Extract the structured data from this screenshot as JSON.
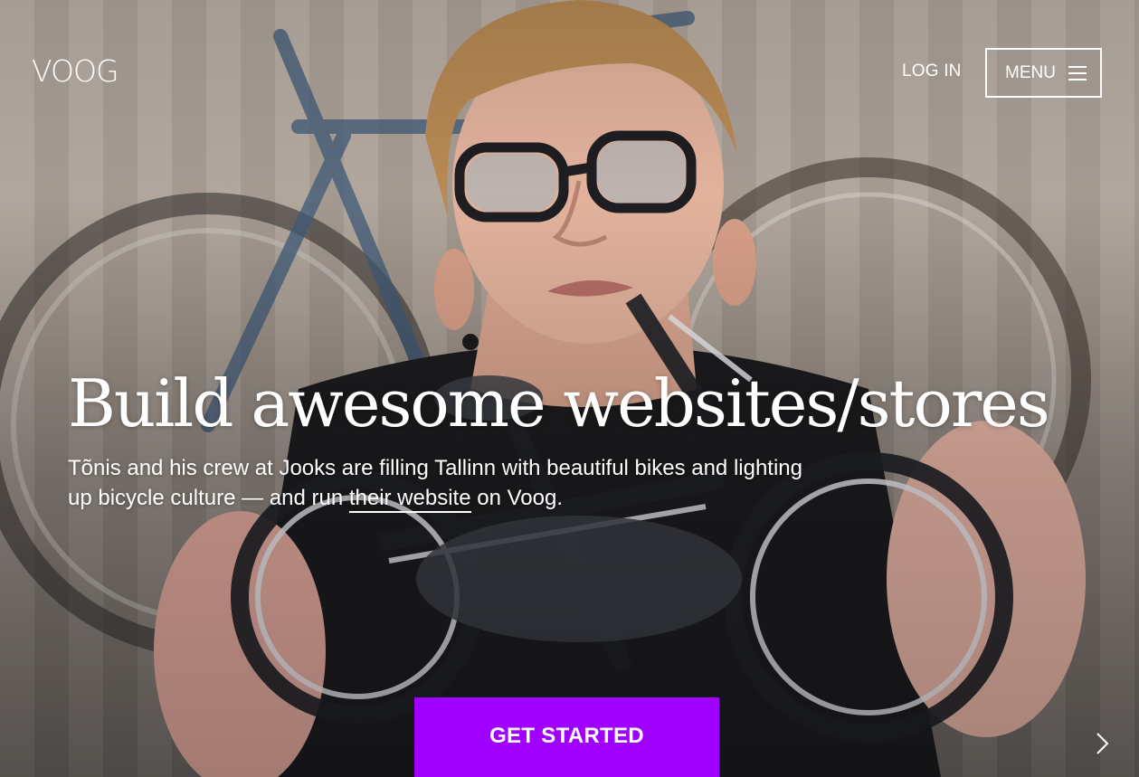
{
  "header": {
    "logo_text": "VOOG",
    "login_label": "LOG IN",
    "menu_label": "MENU",
    "menu_icon": "hamburger-menu-icon"
  },
  "hero": {
    "headline": "Build awesome websites/stores",
    "subtext_before_link": "Tõnis and his crew at Jooks are filling Tallinn with beautiful bikes and lighting up bicycle culture — and run ",
    "subtext_link": "their website",
    "subtext_after_link": " on Voog.",
    "cta_label": "GET STARTED",
    "next_icon": "chevron-right-icon"
  },
  "colors": {
    "cta_background": "#a000ff",
    "text": "#ffffff"
  }
}
